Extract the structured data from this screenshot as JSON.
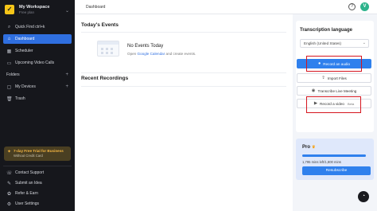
{
  "workspace": {
    "name": "My Workspace",
    "subtitle": "Free plan"
  },
  "sidebar": {
    "quick_find": "Quick Find ctrl+k",
    "items": [
      {
        "label": "Dashboard",
        "icon": "home-icon"
      },
      {
        "label": "Scheduler",
        "icon": "calendar-icon"
      },
      {
        "label": "Upcoming Video Calls",
        "icon": "video-icon"
      },
      {
        "label": "Folders",
        "icon": "folder-icon"
      },
      {
        "label": "My Devices",
        "icon": "devices-icon"
      },
      {
        "label": "Trash",
        "icon": "trash-icon"
      }
    ],
    "trial": {
      "title": "7-day Free Trial for Business",
      "subtitle": "Without Credit Card"
    },
    "footer_items": [
      {
        "label": "Contact Support",
        "icon": "support-icon"
      },
      {
        "label": "Submit an Idea",
        "icon": "idea-icon"
      },
      {
        "label": "Refer & Earn",
        "icon": "gift-icon"
      },
      {
        "label": "User Settings",
        "icon": "settings-icon"
      }
    ]
  },
  "header": {
    "breadcrumb": "Dashboard",
    "avatar_letter": "V"
  },
  "main": {
    "events_title": "Today's Events",
    "no_events": "No Events Today",
    "events_hint_prefix": "Open ",
    "events_hint_link": "Google Calendar",
    "events_hint_suffix": " and create events.",
    "recordings_title": "Recent Recordings"
  },
  "transcription": {
    "title": "Transcription language",
    "language": "English (United States)",
    "buttons": {
      "record_audio": "Record an audio",
      "import_files": "Import Files",
      "transcribe_live": "Transcribe Live Meeting",
      "record_video": "Record a video",
      "record_video_badge": "Beta"
    }
  },
  "pro": {
    "title": "Pro",
    "minutes_text": "1,795 mins left/1,800 mins",
    "progress_fraction": 0.997,
    "button": "Resubscribe"
  },
  "colors": {
    "accent": "#2f80ed",
    "sidebar_bg": "#16171c",
    "highlight": "#d6161f"
  }
}
